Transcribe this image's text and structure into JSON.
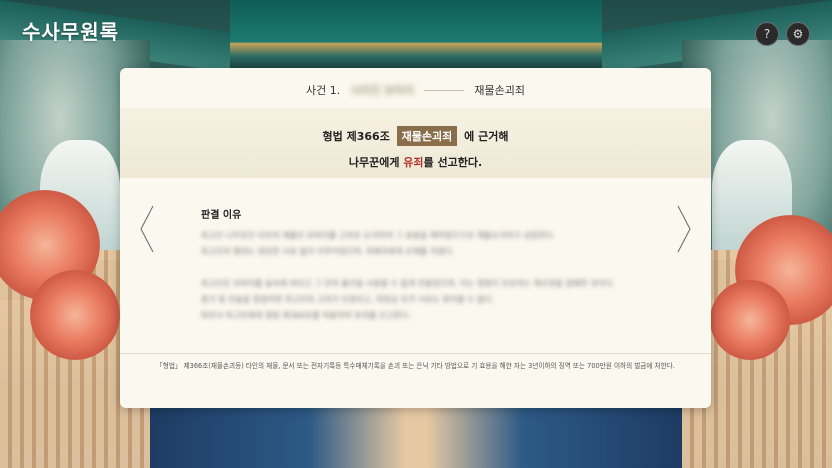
{
  "app": {
    "title": "수사무원록"
  },
  "header": {
    "help_icon": "question-mark-icon",
    "settings_icon": "gear-icon",
    "help_glyph": "?",
    "settings_glyph": "⚙"
  },
  "card": {
    "breadcrumb": {
      "case_label": "사건 1.",
      "case_name": "사라진 보따리",
      "charge": "재물손괴죄"
    },
    "verdict": {
      "line1_prefix": "형법 제366조",
      "line1_tag": "재물손괴죄",
      "line1_suffix": "에 근거해",
      "line2_prefix": "나무꾼에게 ",
      "line2_highlight": "유죄",
      "line2_suffix": "를 선고한다."
    },
    "reason": {
      "title": "판결 이유",
      "paragraph1_line1": "피고인 나무꾼은 타인의 재물인 보따리를 고의로 손괴하여 그 효용을 해하였으므로 재물손괴죄가 성립한다.",
      "paragraph1_line2": "피고인의 행위는 정당한 사유 없이 이루어졌으며, 피해자에게 손해를 끼쳤다.",
      "paragraph2_line1": "피고인은 보따리를 숲속에 버리고 그 안의 물건을 사용할 수 없게 만들었으며, 이는 형법이 보호하는 재산권을 침해한 것이다.",
      "paragraph2_line2": "증거 및 진술을 종합하면 피고인의 고의가 인정되고, 위법성 조각 사유도 찾아볼 수 없다.",
      "paragraph2_line3": "따라서 피고인에게 형법 제366조를 적용하여 유죄를 선고한다."
    },
    "footnote": "「형법」 제366조(재물손괴등) 타인의 재물, 문서 또는 전자기록등 특수매체기록을 손괴 또는 은닉 기타 방법으로 기 효용을 해한 자는 3년이하의 징역 또는 700만원 이하의 벌금에 처한다.",
    "prev_icon": "chevron-left-icon",
    "next_icon": "chevron-right-icon"
  }
}
